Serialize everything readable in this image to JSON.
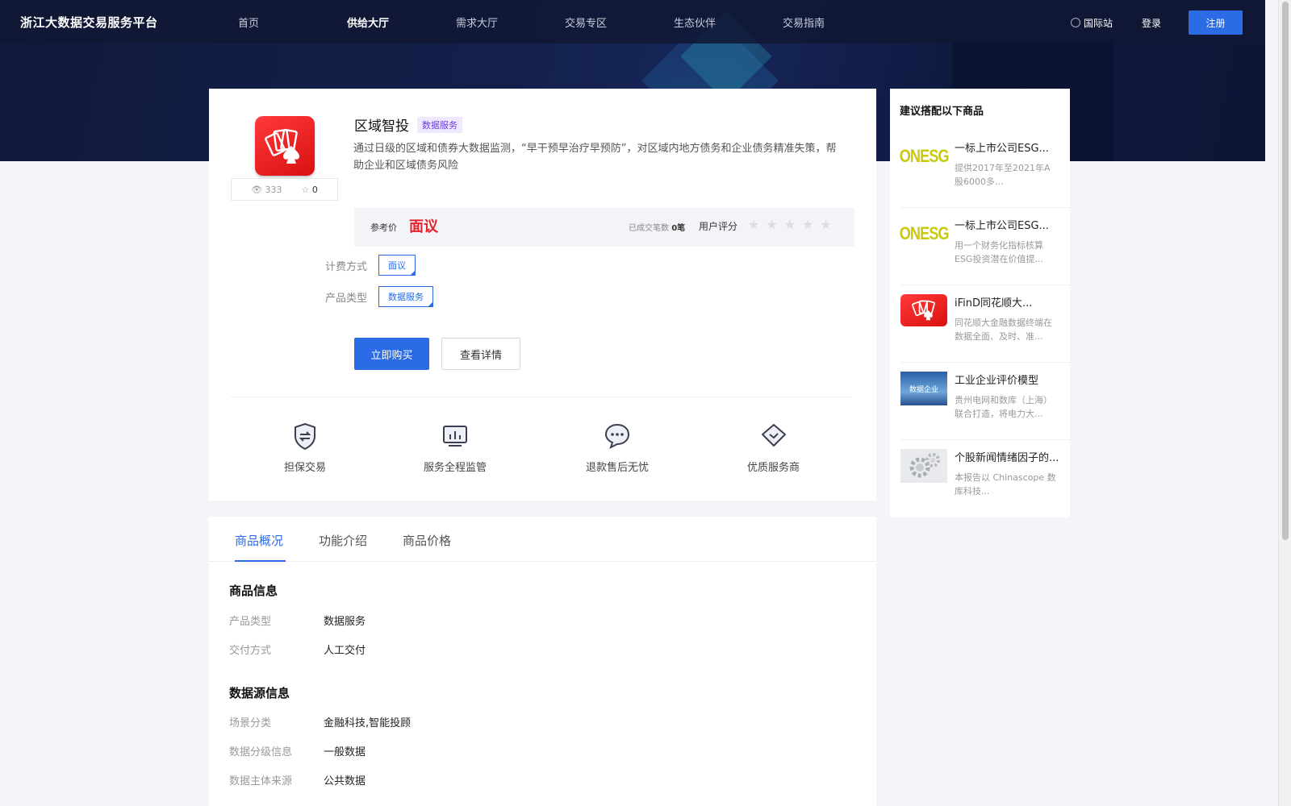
{
  "header": {
    "logo": "浙江大数据交易服务平台",
    "nav": [
      "首页",
      "供给大厅",
      "需求大厅",
      "交易专区",
      "生态伙伴",
      "交易指南"
    ],
    "active_nav": "供给大厅",
    "intl": "国际站",
    "login": "登录",
    "register": "注册"
  },
  "product": {
    "name": "区域智投",
    "tag": "数据服务",
    "description": "通过日级的区域和债券大数据监测，“早干预早治疗早预防”，对区域内地方债务和企业债务精准失策，帮助企业和区域债务风险",
    "views": "333",
    "favorites": "0",
    "ref_price_label": "参考价",
    "ref_price": "面议",
    "deal_label": "已成交笔数",
    "deal_count": "0笔",
    "rating_label": "用户评分",
    "rating": 0,
    "billing_label": "计费方式",
    "billing_value": "面议",
    "type_label": "产品类型",
    "type_value": "数据服务",
    "buy_button": "立即购买",
    "detail_button": "查看详情"
  },
  "features": [
    {
      "label": "担保交易",
      "icon": "shield-exchange-icon"
    },
    {
      "label": "服务全程监管",
      "icon": "monitor-chart-icon"
    },
    {
      "label": "退款售后无忧",
      "icon": "chat-bubble-icon"
    },
    {
      "label": "优质服务商",
      "icon": "diamond-badge-icon"
    }
  ],
  "tabs": [
    "商品概况",
    "功能介绍",
    "商品价格"
  ],
  "active_tab": "商品概况",
  "product_info": {
    "title": "商品信息",
    "rows": [
      {
        "key": "产品类型",
        "value": "数据服务"
      },
      {
        "key": "交付方式",
        "value": "人工交付"
      }
    ]
  },
  "source_info": {
    "title": "数据源信息",
    "rows": [
      {
        "key": "场景分类",
        "value": "金融科技,智能投顾"
      },
      {
        "key": "数据分级信息",
        "value": "一般数据"
      },
      {
        "key": "数据主体来源",
        "value": "公共数据"
      }
    ]
  },
  "sidebar": {
    "title": "建议搭配以下商品",
    "items": [
      {
        "name": "一标上市公司ESG...",
        "desc": "提供2017年至2021年A股6000多...",
        "thumb": "ONESG"
      },
      {
        "name": "一标上市公司ESG...",
        "desc": "用一个财务化指标核算ESG投资潜在价值提...",
        "thumb": "ONESG"
      },
      {
        "name": "iFinD同花顺大...",
        "desc": "同花顺大金融数据终端在数据全面、及时、准...",
        "thumb": "cards-logo"
      },
      {
        "name": "工业企业评价模型",
        "desc": "贵州电网和数库（上海）联合打造，将电力大...",
        "thumb": "数据企业"
      },
      {
        "name": "个股新闻情绪因子的...",
        "desc": "本报告以 Chinascope 数库科技...",
        "thumb": "gears"
      }
    ]
  }
}
